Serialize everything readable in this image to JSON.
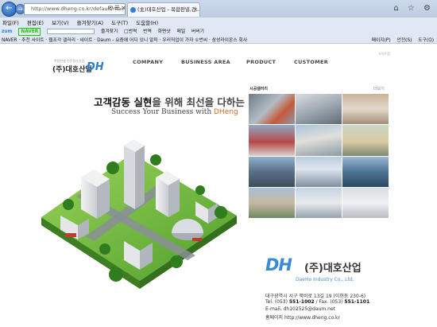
{
  "browser": {
    "address": "http://www.dheng.co.kr/default/main.p",
    "address_icons": "✉ ☰ ×",
    "tab_title": "(主)대호산업 - 복합판넬,건...",
    "tab_close": "×",
    "window_icons": "⌂ ☆ ⚙",
    "menu": [
      "파일(F)",
      "편집(E)",
      "보기(V)",
      "즐겨찾기(A)",
      "도구(T)",
      "도움말(H)"
    ],
    "favbar": {
      "zum": "zum",
      "naver_box": "NAVER",
      "items": [
        "즐겨찾기",
        "□번역",
        "번역",
        "화면샷",
        "메일"
      ],
      "tail": "버버기"
    },
    "cmdbar": {
      "left_items": [
        "NAVER",
        "추천 사이트",
        "웹조각 갤러리",
        "네이트",
        "Daum - 요즘에 어디 있니 알피",
        "우리직업이 가자 ①번씨",
        "삼성라이온스 회사"
      ],
      "right_items": [
        "페이지(P)",
        "안전(S)",
        "도구(O)"
      ]
    }
  },
  "site": {
    "logo_small": "복합판넬 전문생산기업",
    "logo_main": "(주)대호산업",
    "logo_dh": "DH",
    "sitemap": "사이트맵",
    "nav": [
      "COMPANY",
      "BUSINESS AREA",
      "PRODUCT",
      "CUSTOMER"
    ],
    "headline_a": "고객감동 실현",
    "headline_b": "을 위해 최선을 다하는 기업",
    "sub_en_a": "Success Your Business with ",
    "sub_en_b": "DHeng",
    "gallery_title": "시공갤러리",
    "gallery_more": "더보기",
    "company": {
      "dh": "DH",
      "name": "(주)대호산업",
      "name_en": "DaeHo Industry Co., Ltd.",
      "address": "대구광역시 서구 북비로 13길 19 (이현동 230-6)",
      "tel_label": "Tel. (053)",
      "tel": "551-1002",
      "fax_label": " / Fax. (053) ",
      "fax": "551-1101",
      "email": "E-mail. dh102525@daum.net",
      "homepage": "홈페이지 http://www.dheng.co.kr"
    }
  },
  "colors": {
    "accent_blue": "#2e7ec8",
    "brand_orange": "#e06a1a",
    "grass_green": "#6cbf3a"
  }
}
